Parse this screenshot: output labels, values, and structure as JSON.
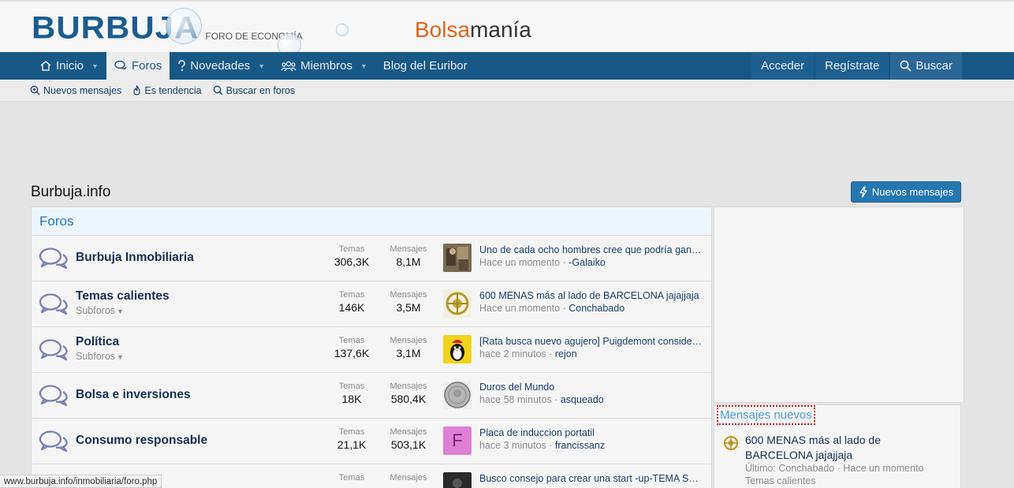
{
  "header": {
    "logo_main": "BURBUJA",
    "logo_sub": "FORO DE ECONOMÍA",
    "partner_logo_part1": "Bolsa",
    "partner_logo_part2": "manía"
  },
  "nav": {
    "items": [
      {
        "label": "Inicio",
        "icon": "home-icon",
        "has_menu": true
      },
      {
        "label": "Foros",
        "icon": "comments-icon",
        "active": true
      },
      {
        "label": "Novedades",
        "icon": "question-bulb-icon",
        "has_menu": true
      },
      {
        "label": "Miembros",
        "icon": "users-icon",
        "has_menu": true
      },
      {
        "label": "Blog del Euribor"
      }
    ],
    "login": "Acceder",
    "register": "Regístrate",
    "search": "Buscar"
  },
  "subnav": {
    "items": [
      {
        "label": "Nuevos mensajes",
        "icon": "zoom-icon"
      },
      {
        "label": "Es tendencia",
        "icon": "flame-icon"
      },
      {
        "label": "Buscar en foros",
        "icon": "search-icon"
      }
    ]
  },
  "page": {
    "title": "Burbuja.info",
    "new_posts_button": "Nuevos mensajes"
  },
  "forums": {
    "header": "Foros",
    "temas_label": "Temas",
    "mensajes_label": "Mensajes",
    "subforos_label": "Subforos",
    "rows": [
      {
        "title": "Burbuja Inmobiliaria",
        "subforos": false,
        "temas": "306,3K",
        "mensajes": "8,1M",
        "last_title": "Uno de cada ocho hombres cree que podría ganarle un punto a Serena Williams",
        "last_time": "Hace un momento",
        "last_user": "-Galaiko",
        "avatar": "photo-brown"
      },
      {
        "title": "Temas calientes",
        "subforos": true,
        "temas": "146K",
        "mensajes": "3,5M",
        "last_title": "600 MENAS más al lado de BARCELONA jajajjaja",
        "last_time": "Hace un momento",
        "last_user": "Conchabado",
        "avatar": "gold-emblem"
      },
      {
        "title": "Política",
        "subforos": true,
        "temas": "137,6K",
        "mensajes": "3,1M",
        "last_title": "[Rata busca nuevo agujero] Puigdemont considera volver a España",
        "last_time": "hace 2 minutos",
        "last_user": "rejon",
        "avatar": "penguin-yellow"
      },
      {
        "title": "Bolsa e inversiones",
        "subforos": false,
        "temas": "18K",
        "mensajes": "580,4K",
        "last_title": "Duros del Mundo",
        "last_time": "hace 58 minutos",
        "last_user": "asqueado",
        "avatar": "silver-coin"
      },
      {
        "title": "Consumo responsable",
        "subforos": false,
        "temas": "21,1K",
        "mensajes": "503,1K",
        "last_title": "Placa de induccion portatil",
        "last_time": "hace 3 minutos",
        "last_user": "francissanz",
        "avatar_letter": "F",
        "avatar": "letter-pink"
      },
      {
        "title": "",
        "subforos": false,
        "temas": "",
        "mensajes": "",
        "last_title": "Busco consejo para crear una start -up-TEMA SERIO",
        "last_time": "",
        "last_user": "",
        "avatar": "photo-dark"
      }
    ]
  },
  "sidebar": {
    "new_posts_title": "Mensajes nuevos",
    "post_title": "600 MENAS más al lado de BARCELONA jajajjaja",
    "post_meta": "Último: Conchabado · Hace un momento",
    "post_forum": "Temas calientes"
  },
  "statusbar": {
    "url": "www.burbuja.info/inmobiliaria/foro.php"
  },
  "colors": {
    "nav_bg": "#185886",
    "accent": "#2577b1",
    "link": "#1a3e6a",
    "partner_orange": "#e2641b",
    "focus_outline": "#d01818"
  }
}
